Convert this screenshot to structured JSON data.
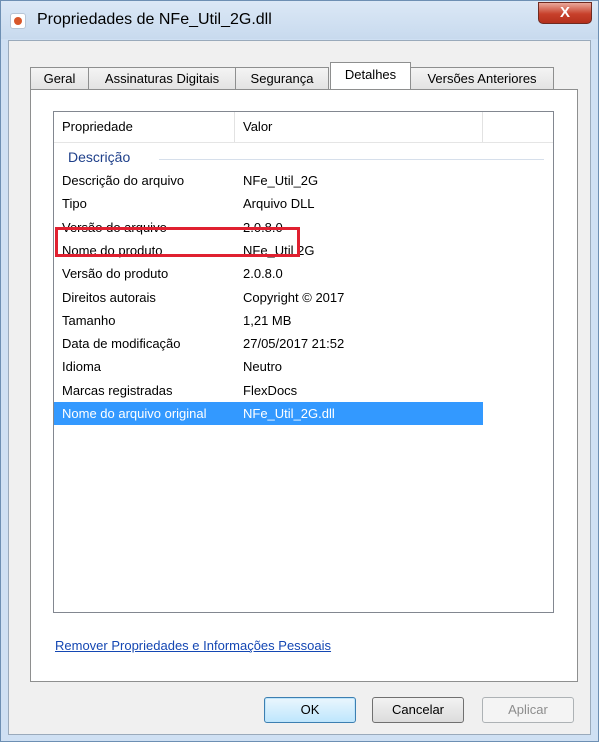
{
  "window": {
    "title": "Propriedades de NFe_Util_2G.dll",
    "close_label": "X"
  },
  "tabs": [
    {
      "label": "Geral"
    },
    {
      "label": "Assinaturas Digitais"
    },
    {
      "label": "Segurança"
    },
    {
      "label": "Detalhes",
      "active": true
    },
    {
      "label": "Versões Anteriores"
    }
  ],
  "list": {
    "columns": {
      "property": "Propriedade",
      "value": "Valor"
    },
    "group": "Descrição",
    "rows": [
      {
        "key": "Descrição do arquivo",
        "value": "NFe_Util_2G"
      },
      {
        "key": "Tipo",
        "value": "Arquivo DLL"
      },
      {
        "key": "Versão do arquivo",
        "value": "2.0.8.0",
        "highlighted": true
      },
      {
        "key": "Nome do produto",
        "value": "NFe_Util 2G"
      },
      {
        "key": "Versão do produto",
        "value": "2.0.8.0"
      },
      {
        "key": "Direitos autorais",
        "value": "Copyright © 2017"
      },
      {
        "key": "Tamanho",
        "value": "1,21 MB"
      },
      {
        "key": "Data de modificação",
        "value": "27/05/2017 21:52"
      },
      {
        "key": "Idioma",
        "value": "Neutro"
      },
      {
        "key": "Marcas registradas",
        "value": "FlexDocs"
      },
      {
        "key": "Nome do arquivo original",
        "value": "NFe_Util_2G.dll",
        "selected": true
      }
    ]
  },
  "link": "Remover Propriedades e Informações Pessoais",
  "buttons": {
    "ok": "OK",
    "cancel": "Cancelar",
    "apply": "Aplicar"
  },
  "colors": {
    "selection": "#3399ff",
    "highlight_border": "#e02030",
    "group_label": "#1e3f8a",
    "link": "#1447b3"
  }
}
